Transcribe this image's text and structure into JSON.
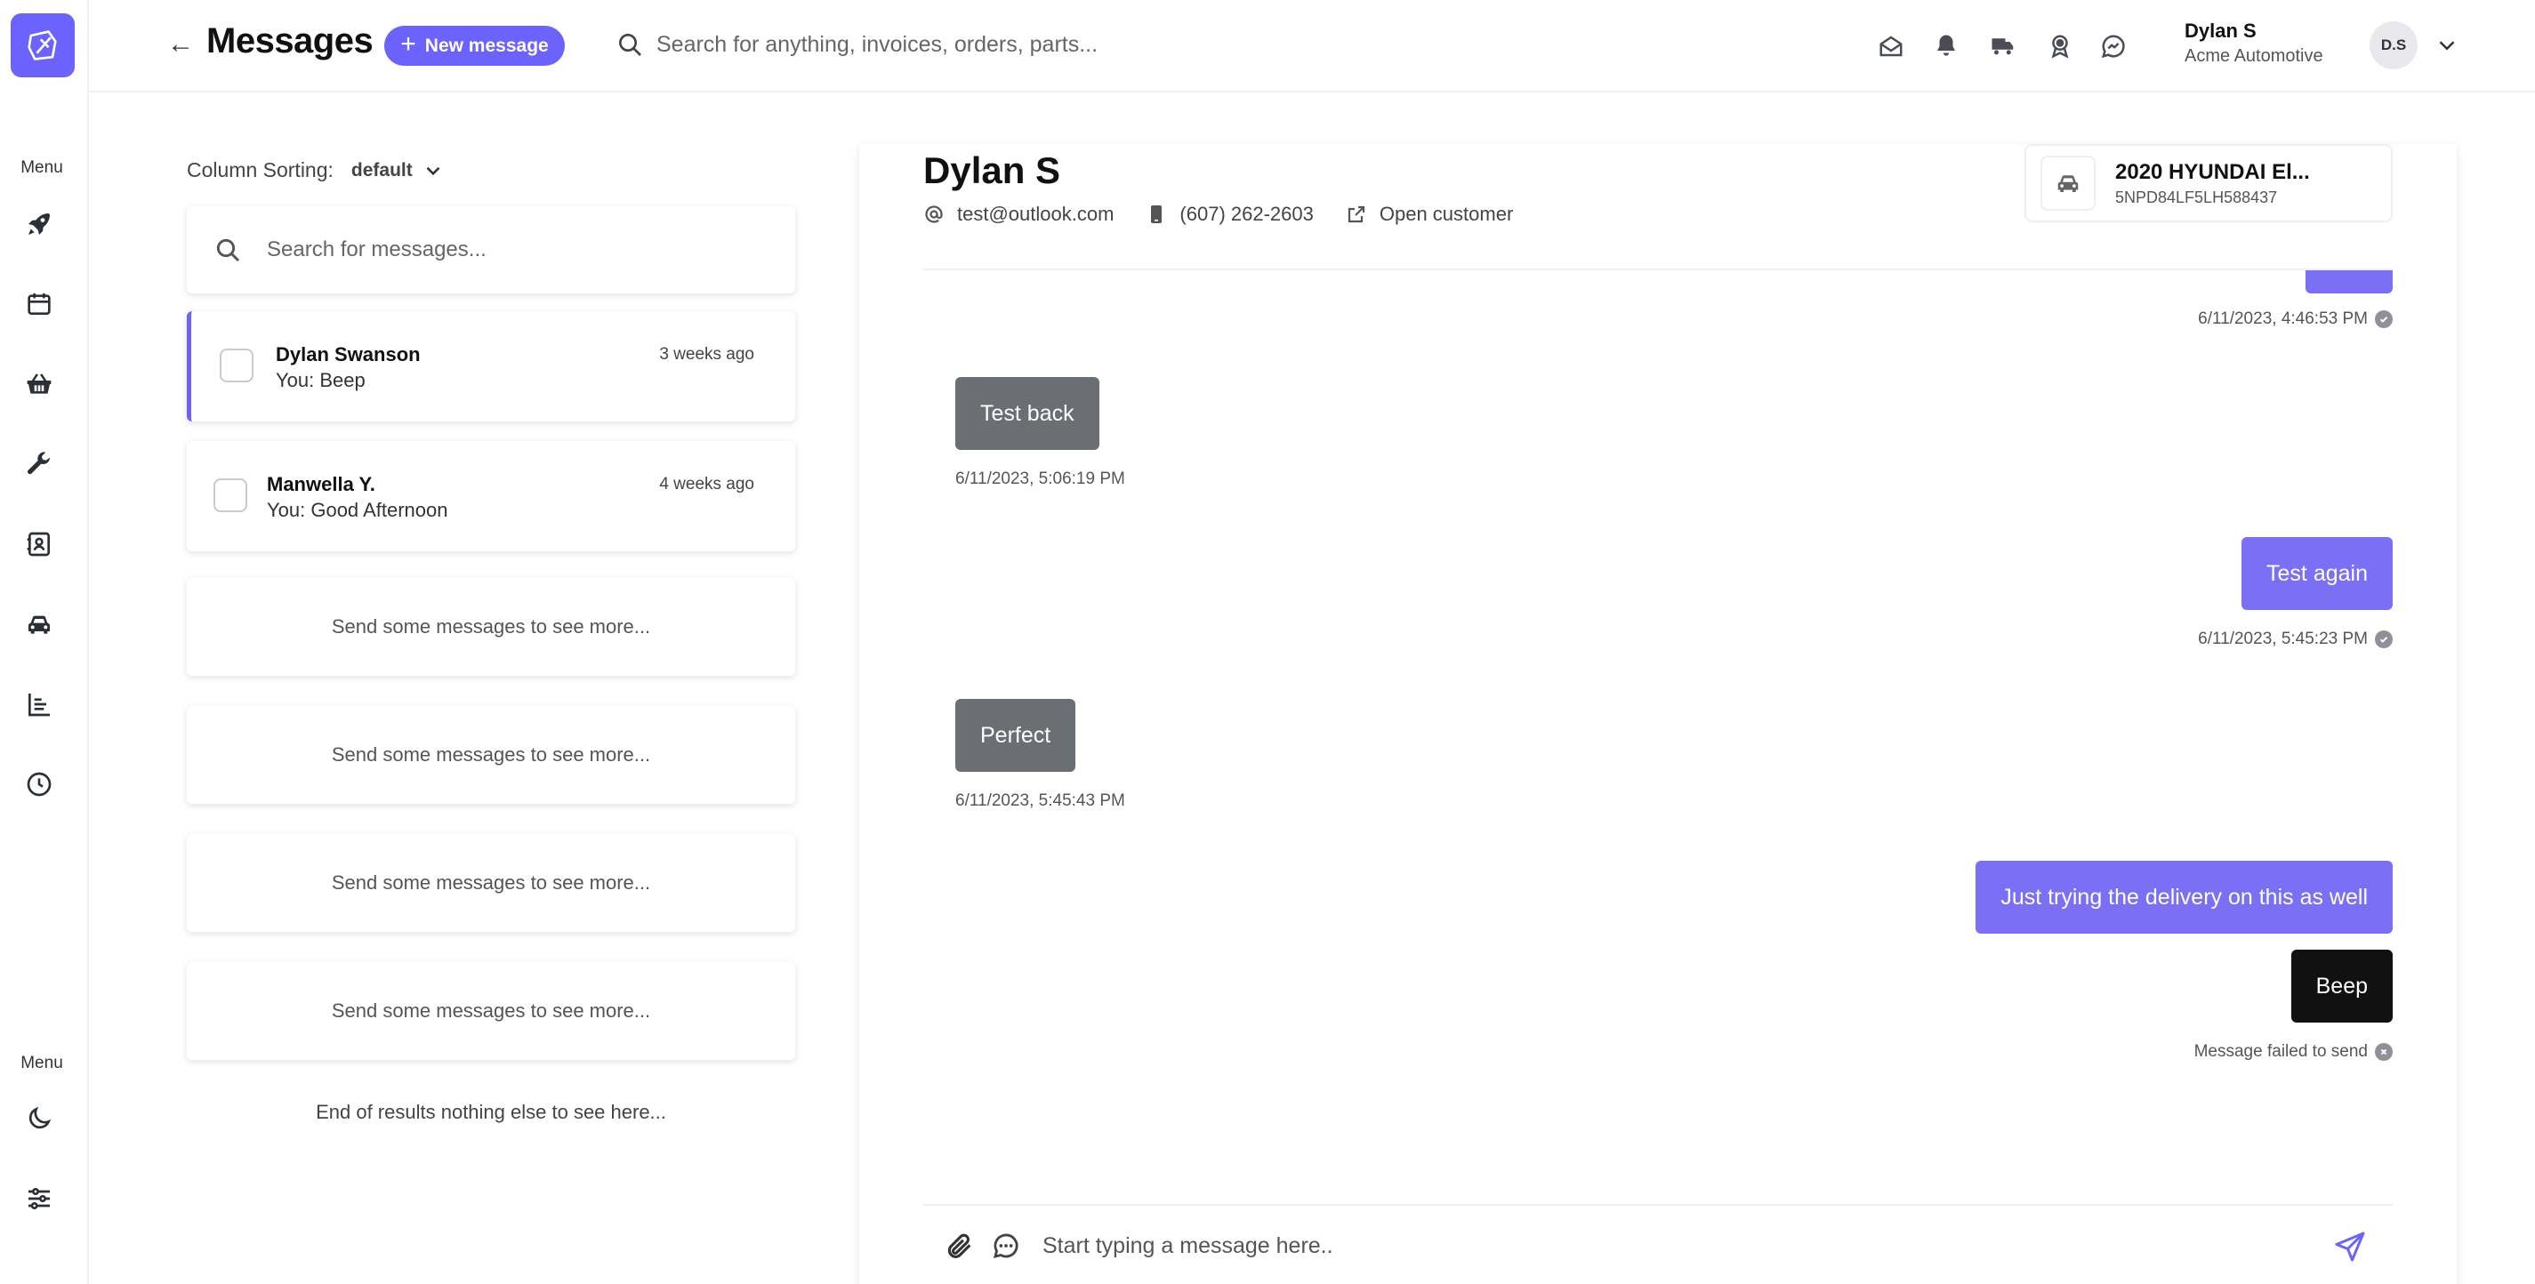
{
  "header": {
    "title": "Messages",
    "new_message_label": "New message",
    "search_placeholder": "Search for anything, invoices, orders, parts...",
    "user": {
      "name": "Dylan S",
      "company": "Acme Automotive",
      "initials": "D.S"
    }
  },
  "rail": {
    "top_label": "Menu",
    "bottom_label": "Menu",
    "items": [
      "rocket-icon",
      "calendar-icon",
      "basket-icon",
      "wrench-icon",
      "contacts-icon",
      "car-icon",
      "reports-icon",
      "clock-icon"
    ],
    "bottom_items": [
      "moon-icon",
      "sliders-icon"
    ]
  },
  "list": {
    "sort_label": "Column Sorting:",
    "sort_value": "default",
    "search_placeholder": "Search for messages...",
    "conversations": [
      {
        "name": "Dylan Swanson",
        "preview": "You: Beep",
        "time": "3 weeks ago",
        "active": true
      },
      {
        "name": "Manwella Y.",
        "preview": "You: Good Afternoon",
        "time": "4 weeks ago",
        "active": false
      }
    ],
    "placeholder_text": "Send some messages to see more...",
    "end_text": "End of results nothing else to see here..."
  },
  "chat": {
    "contact_name": "Dylan S",
    "email": "test@outlook.com",
    "phone": "(607) 262-2603",
    "open_customer_label": "Open customer",
    "vehicle": {
      "title": "2020 HYUNDAI El...",
      "vin": "5NPD84LF5LH588437"
    },
    "messages": [
      {
        "direction": "out",
        "text": "",
        "time": "6/11/2023, 4:46:53 PM",
        "status": "delivered"
      },
      {
        "direction": "in",
        "text": "Test back",
        "time": "6/11/2023, 5:06:19 PM"
      },
      {
        "direction": "out",
        "text": "Test again",
        "time": "6/11/2023, 5:45:23 PM",
        "status": "delivered"
      },
      {
        "direction": "in",
        "text": "Perfect",
        "time": "6/11/2023, 5:45:43 PM"
      },
      {
        "direction": "out",
        "text": "Just trying the delivery on this as well"
      },
      {
        "direction": "out",
        "text": "Beep",
        "status": "failed",
        "status_text": "Message failed to send"
      }
    ],
    "composer_placeholder": "Start typing a message here.."
  },
  "colors": {
    "accent": "#6c63ff",
    "outgoing_bubble": "#7b6ff5",
    "incoming_bubble": "#6b6e73",
    "failed_bubble": "#111111"
  }
}
